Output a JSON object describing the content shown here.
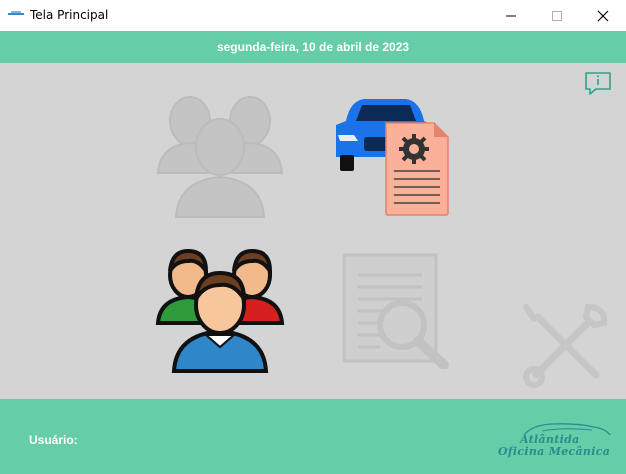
{
  "window": {
    "title": "Tela Principal"
  },
  "header": {
    "date": "segunda-feira, 10 de abril de 2023"
  },
  "footer": {
    "user_label": "Usuário:",
    "brand_line1": "Atlântida",
    "brand_line2": "Oficina Mecânica"
  },
  "colors": {
    "accent": "#66cda9",
    "canvas": "#d4d4d4"
  },
  "icons": {
    "info": "info-icon",
    "clients_disabled": "users-group-icon",
    "vehicle_report": "car-document-icon",
    "clients": "users-group-icon",
    "search_document_disabled": "search-document-icon",
    "tools_disabled": "tools-icon"
  }
}
